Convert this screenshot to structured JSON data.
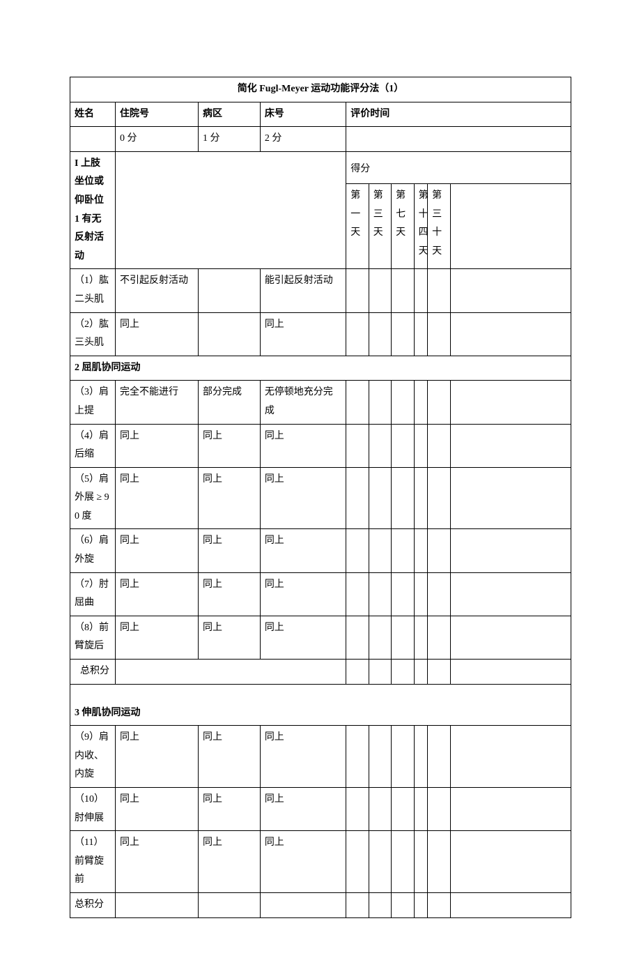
{
  "title": "简化 Fugl-Meyer 运动功能评分法（1）",
  "header": {
    "name_label": "姓名",
    "admission_label": "住院号",
    "ward_label": "病区",
    "bed_label": "床号",
    "eval_time_label": "评价时间"
  },
  "score_cols": {
    "c0": "0 分",
    "c1": "1 分",
    "c2": "2 分"
  },
  "section_i": "I 上肢  坐位或仰卧位",
  "section1": "1 有无反射活动",
  "score_label": "得分",
  "days": {
    "d1": "第一天",
    "d3": "第三天",
    "d7": "第七天",
    "d14": "第十四天",
    "d30": "第三十天"
  },
  "rows1": {
    "r1": {
      "label": "（1）肱二头肌",
      "a": "不引起反射活动",
      "b": "",
      "c": "能引起反射活动"
    },
    "r2": {
      "label": "（2）肱三头肌",
      "a": "同上",
      "b": "",
      "c": "同上"
    }
  },
  "section2": "2 屈肌协同运动",
  "rows2": {
    "r3": {
      "label": "（3）肩上提",
      "a": "完全不能进行",
      "b": "部分完成",
      "c": "无停顿地充分完成"
    },
    "r4": {
      "label": "（4）肩后缩",
      "a": "同上",
      "b": "同上",
      "c": "同上"
    },
    "r5": {
      "label": "（5）肩外展 ≥ 90 度",
      "a": "同上",
      "b": "同上",
      "c": "同上"
    },
    "r6": {
      "label": "（6）肩外旋",
      "a": "同上",
      "b": "同上",
      "c": "同上"
    },
    "r7": {
      "label": "（7）肘屈曲",
      "a": "同上",
      "b": "同上",
      "c": "同上"
    },
    "r8": {
      "label": "（8）前臂旋后",
      "a": "同上",
      "b": "同上",
      "c": "同上"
    }
  },
  "subtotal": "总积分",
  "section3": "3 伸肌协同运动",
  "rows3": {
    "r9": {
      "label": "（9）肩内收、内旋",
      "a": "同上",
      "b": "同上",
      "c": "同上"
    },
    "r10": {
      "label": "（10）肘伸展",
      "a": "同上",
      "b": "同上",
      "c": "同上"
    },
    "r11": {
      "label": "（11）前臂旋前",
      "a": "同上",
      "b": "同上",
      "c": "同上"
    }
  },
  "total": "总积分"
}
